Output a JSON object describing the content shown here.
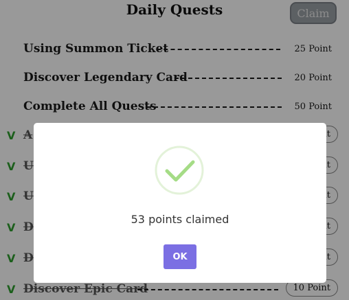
{
  "header": {
    "title": "Daily Quests",
    "claim_label": "Claim"
  },
  "quests": [
    {
      "name": "Using Summon Ticket",
      "points": "25 Point",
      "done": false
    },
    {
      "name": "Discover Legendary Card",
      "points": "20 Point",
      "done": false
    },
    {
      "name": "Complete All Quests",
      "points": "50 Point",
      "done": false
    },
    {
      "name": "A",
      "points": "Point",
      "done": true
    },
    {
      "name": "U",
      "points": "Point",
      "done": true
    },
    {
      "name": "U",
      "points": "Point",
      "done": true
    },
    {
      "name": "D",
      "points": "Point",
      "done": true
    },
    {
      "name": "D",
      "points": "Point",
      "done": true
    },
    {
      "name": "Discover Epic Card",
      "points": "10 Point",
      "done": true
    }
  ],
  "check_mark": "V",
  "modal": {
    "message": "53 points claimed",
    "ok_label": "OK",
    "icon": "check-circle-icon"
  },
  "colors": {
    "accent": "#7b6fe3",
    "success": "#a5dc86",
    "check": "#2f9e2f"
  }
}
